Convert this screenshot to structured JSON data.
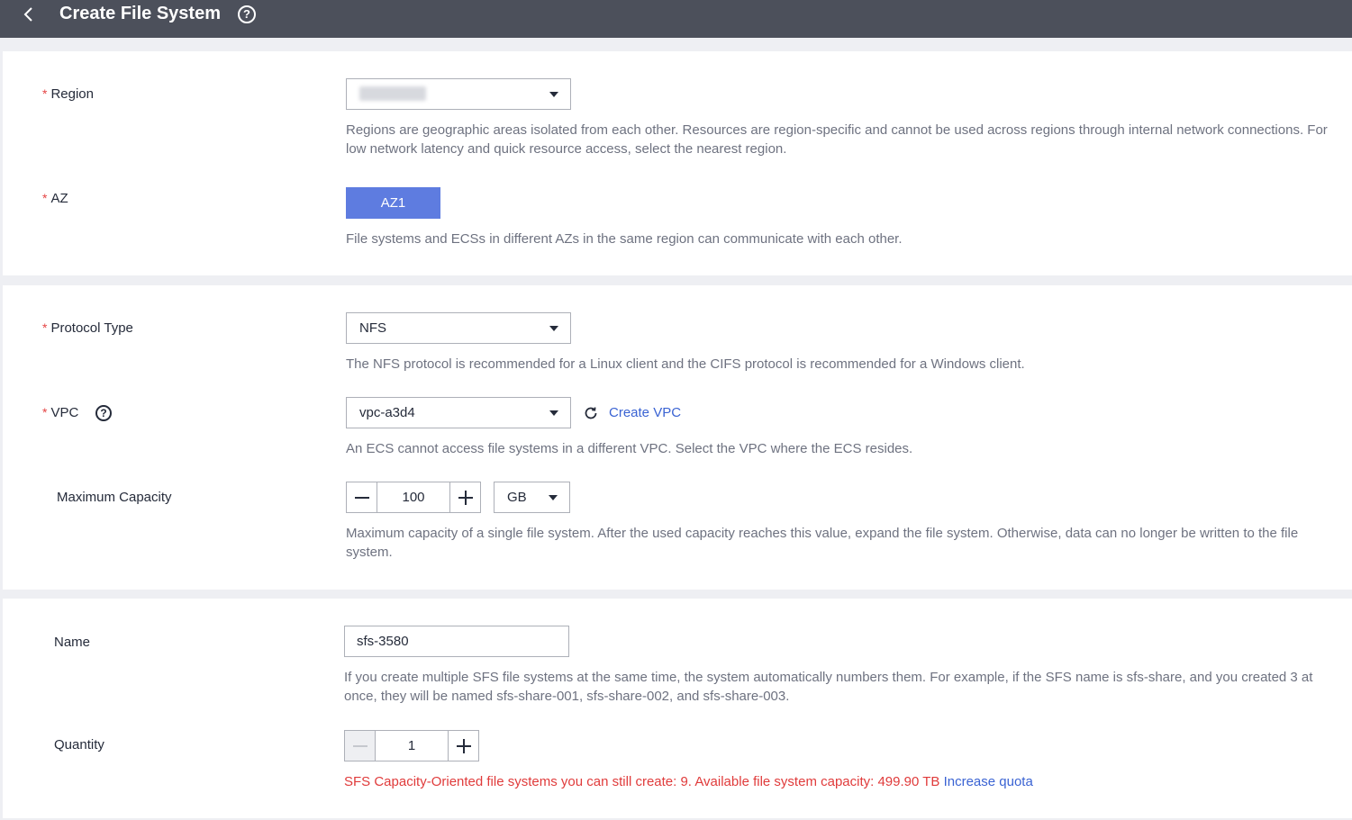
{
  "header": {
    "title": "Create File System",
    "help": "?"
  },
  "region": {
    "label": "Region",
    "required": "*",
    "hint": "Regions are geographic areas isolated from each other. Resources are region-specific and cannot be used across regions through internal network connections. For low network latency and quick resource access, select the nearest region."
  },
  "az": {
    "label": "AZ",
    "required": "*",
    "selected": "AZ1",
    "hint": "File systems and ECSs in different AZs in the same region can communicate with each other."
  },
  "protocol": {
    "label": "Protocol Type",
    "required": "*",
    "value": "NFS",
    "hint": "The NFS protocol is recommended for a Linux client and the CIFS protocol is recommended for a Windows client."
  },
  "vpc": {
    "label": "VPC",
    "required": "*",
    "help": "?",
    "value": "vpc-a3d4",
    "create_link": "Create VPC",
    "hint": "An ECS cannot access file systems in a different VPC. Select the VPC where the ECS resides."
  },
  "capacity": {
    "label": "Maximum Capacity",
    "value": "100",
    "unit": "GB",
    "hint": "Maximum capacity of a single file system. After the used capacity reaches this value, expand the file system. Otherwise, data can no longer be written to the file system."
  },
  "name": {
    "label": "Name",
    "value": "sfs-3580",
    "hint": "If you create multiple SFS file systems at the same time, the system automatically numbers them. For example, if the SFS name is sfs-share, and you created 3 at once, they will be named sfs-share-001, sfs-share-002, and sfs-share-003."
  },
  "quantity": {
    "label": "Quantity",
    "value": "1",
    "quota_text": "SFS Capacity-Oriented file systems you can still create: 9. Available file system capacity: 499.90 TB",
    "quota_link": "Increase quota"
  },
  "colors": {
    "primary": "#5e7ce0",
    "header_bg": "#4c505b",
    "error": "#e03b3b",
    "link": "#3a63d3"
  }
}
